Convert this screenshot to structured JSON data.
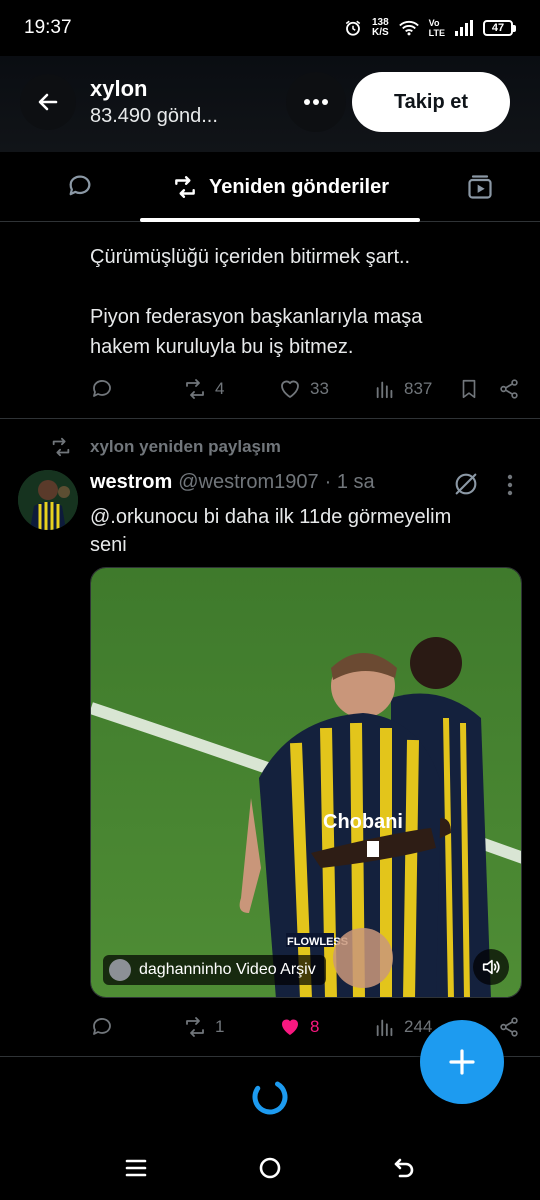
{
  "status_bar": {
    "time": "19:37",
    "net_speed_value": "138",
    "net_speed_unit": "K/S",
    "volte_top": "Vo",
    "volte_bottom": "LTE",
    "battery": "47"
  },
  "header": {
    "name": "xylon",
    "post_count": "83.490 gönd...",
    "follow_label": "Takip et"
  },
  "tabs": {
    "active_label": "Yeniden gönderiler",
    "left_icon": "chat-bubble-icon",
    "right_icon": "video-icon"
  },
  "post1": {
    "line1": "Çürümüşlüğü içeriden bitirmek şart..",
    "line2": "Piyon federasyon başkanlarıyla maşa",
    "line3": "hakem kuruluyla bu iş bitmez.",
    "reposts": "4",
    "likes": "33",
    "views": "837"
  },
  "post2": {
    "repost_label": "xylon yeniden paylaşım",
    "author_name": "westrom",
    "author_handle": "@westrom1907",
    "time": "· 1 sa",
    "text_line1": "@.orkunocu bi daha ilk 11de görmeyelim",
    "text_line2": "seni",
    "media_credit": "daghanninho Video Arşiv",
    "reposts": "1",
    "likes": "8",
    "views": "244"
  },
  "colors": {
    "accent": "#1d9bf0",
    "like_active": "#f91880",
    "muted": "#71767b",
    "background": "#000000"
  }
}
